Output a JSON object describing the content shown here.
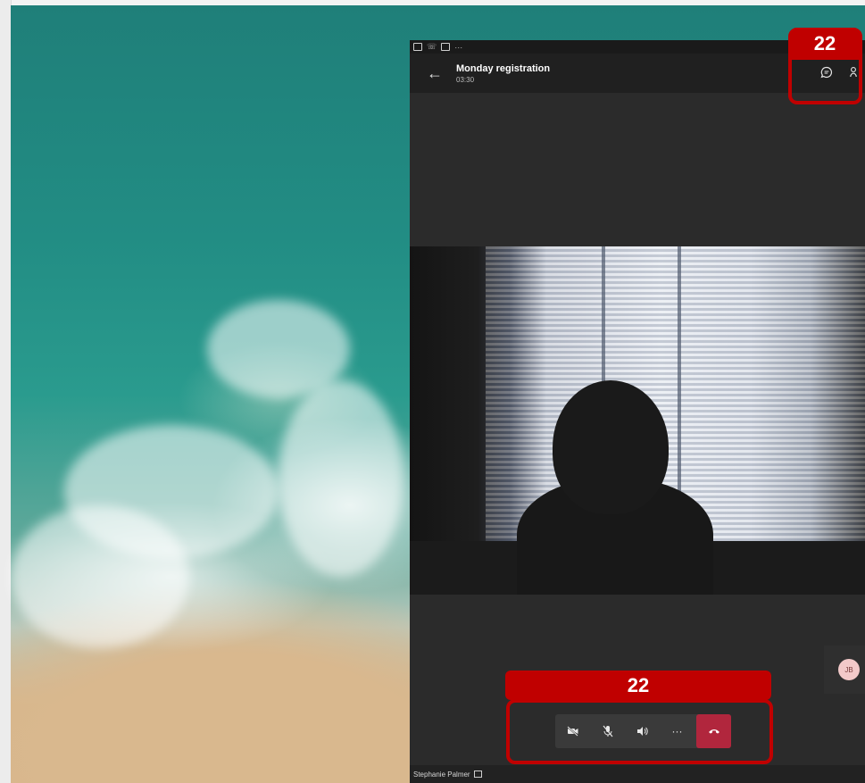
{
  "call": {
    "title": "Monday registration",
    "time": "03:30",
    "participant_name": "Stephanie Palmer",
    "self_initials": "JB"
  },
  "icons": {
    "back": "arrow-left-icon",
    "chat": "chat-bubble-icon",
    "people": "people-icon",
    "video_off": "video-off-icon",
    "mic_off": "mic-off-icon",
    "speaker": "speaker-icon",
    "more": "more-options-icon",
    "hangup": "hang-up-icon"
  },
  "controls": {
    "more_label": "···"
  },
  "annotations": {
    "top_label": "22",
    "bottom_label": "22",
    "color": "#c00000"
  },
  "colors": {
    "hangup": "#b1263d",
    "app_bg": "#2b2b2b"
  }
}
